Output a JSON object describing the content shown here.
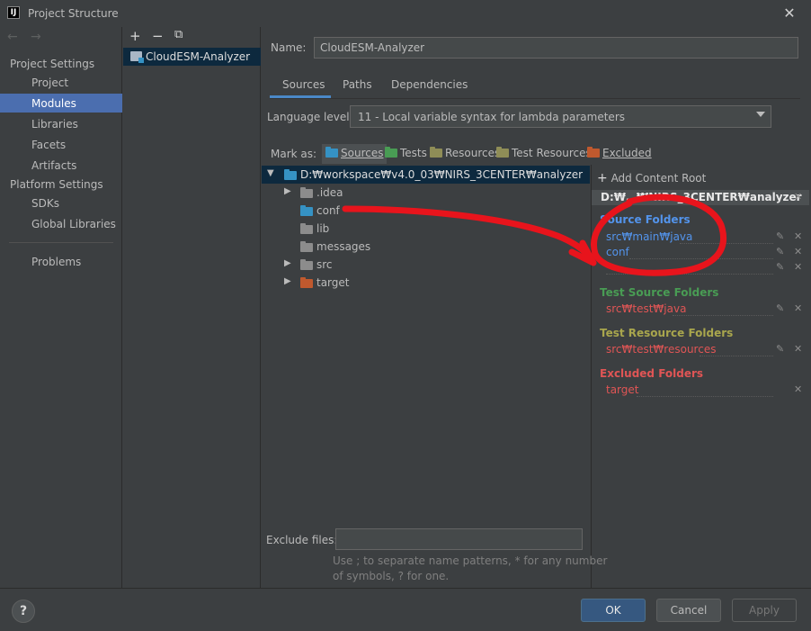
{
  "window": {
    "title": "Project Structure",
    "app_icon": "IJ"
  },
  "nav": {
    "back": "←",
    "forward": "→",
    "groups": [
      {
        "label": "Project Settings",
        "items": [
          "Project",
          "Modules",
          "Libraries",
          "Facets",
          "Artifacts"
        ]
      },
      {
        "label": "Platform Settings",
        "items": [
          "SDKs",
          "Global Libraries"
        ]
      }
    ],
    "problems": "Problems",
    "selected": "Modules"
  },
  "modules": {
    "toolbar": {
      "add": "+",
      "remove": "−",
      "copy": "⧉"
    },
    "items": [
      "CloudESM-Analyzer"
    ]
  },
  "detail": {
    "name_label": "Name:",
    "name_value": "CloudESM-Analyzer",
    "tabs": [
      "Sources",
      "Paths",
      "Dependencies"
    ],
    "active_tab": "Sources",
    "language_label": "Language level:",
    "language_value": "11 - Local variable syntax for lambda parameters",
    "mark_as_label": "Mark as:",
    "mark_as": [
      "Sources",
      "Tests",
      "Resources",
      "Test Resources",
      "Excluded"
    ],
    "tree": {
      "root": "D:₩workspace₩v4.0_03₩NIRS_3CENTER₩analyzer",
      "children": [
        ".idea",
        "conf",
        "lib",
        "messages",
        "src",
        "target"
      ]
    },
    "exclude_label": "Exclude files:",
    "exclude_value": "",
    "exclude_hint_1": "Use ; to separate name patterns, * for any number",
    "exclude_hint_2": "of symbols, ? for one."
  },
  "roots": {
    "add_content_root": "Add Content Root",
    "root_path": "D:₩…₩NIRS_3CENTER₩analyzer",
    "source_title": "Source Folders",
    "source_items": [
      "src₩main₩java",
      "conf"
    ],
    "test_source_title": "Test Source Folders",
    "test_source_items": [
      "src₩test₩java"
    ],
    "test_resource_title": "Test Resource Folders",
    "test_resource_items": [
      "src₩test₩resources"
    ],
    "excluded_title": "Excluded Folders",
    "excluded_items": [
      "target"
    ]
  },
  "buttons": {
    "help": "?",
    "ok": "OK",
    "cancel": "Cancel",
    "apply": "Apply"
  },
  "colors": {
    "source": "#5394ec",
    "test": "#499c54",
    "resource": "#a9a64d",
    "test_resource": "#a9a64d",
    "excluded": "#e05555",
    "annotation": "#e8141c"
  }
}
